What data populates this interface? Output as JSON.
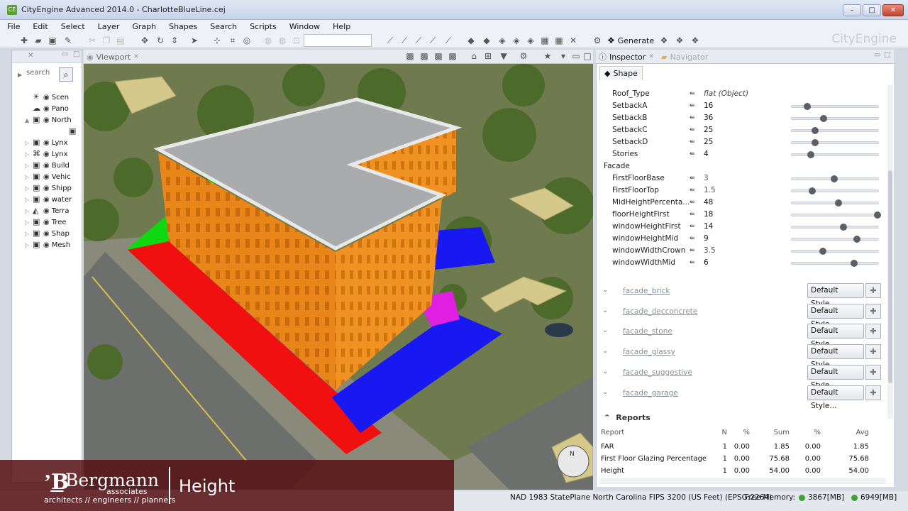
{
  "window": {
    "title": "CityEngine Advanced 2014.0 - CharlotteBlueLine.cej",
    "brand": "CityEngine"
  },
  "menu": [
    "File",
    "Edit",
    "Select",
    "Layer",
    "Graph",
    "Shapes",
    "Search",
    "Scripts",
    "Window",
    "Help"
  ],
  "toolbar": {
    "generate_label": "Generate"
  },
  "scene": {
    "search_placeholder": "search",
    "layers": [
      {
        "label": "Scen",
        "icon": "sun-icon"
      },
      {
        "label": "Pano",
        "icon": "cloud-icon"
      },
      {
        "label": "North",
        "icon": "cube-icon"
      },
      {
        "label": "",
        "icon": "cube-icon"
      },
      {
        "label": "Lynx",
        "icon": "cube-icon"
      },
      {
        "label": "Lynx",
        "icon": "network-icon"
      },
      {
        "label": "Build",
        "icon": "cube-icon"
      },
      {
        "label": "Vehic",
        "icon": "cube-icon"
      },
      {
        "label": "Shipp",
        "icon": "cube-icon"
      },
      {
        "label": "water",
        "icon": "cube-icon"
      },
      {
        "label": "Terra",
        "icon": "terrain-icon"
      },
      {
        "label": "Tree",
        "icon": "cube-icon"
      },
      {
        "label": "Shap",
        "icon": "cube-icon"
      },
      {
        "label": "Mesh",
        "icon": "cube-icon"
      }
    ]
  },
  "viewport": {
    "tab_label": "Viewport"
  },
  "inspector": {
    "tab_label": "Inspector",
    "navigator_label": "Navigator",
    "shape_tab": "Shape",
    "attributes": [
      {
        "name": "Roof_Type",
        "value": "flat (Object)",
        "slider": null
      },
      {
        "name": "SetbackA",
        "value": "16",
        "slider": 0.18
      },
      {
        "name": "SetbackB",
        "value": "36",
        "slider": 0.37
      },
      {
        "name": "SetbackC",
        "value": "25",
        "slider": 0.27
      },
      {
        "name": "SetbackD",
        "value": "25",
        "slider": 0.27
      },
      {
        "name": "Stories",
        "value": "4",
        "slider": 0.22
      }
    ],
    "facade_group": "Facade",
    "facade_attributes": [
      {
        "name": "FirstFloorBase",
        "value": "3",
        "slider": 0.49,
        "default": true
      },
      {
        "name": "FirstFloorTop",
        "value": "1.5",
        "slider": 0.24,
        "default": true
      },
      {
        "name": "MidHeightPercenta...",
        "value": "48",
        "slider": 0.54
      },
      {
        "name": "floorHeightFirst",
        "value": "18",
        "slider": 0.99
      },
      {
        "name": "windowHeightFirst",
        "value": "14",
        "slider": 0.6
      },
      {
        "name": "windowHeightMid",
        "value": "9",
        "slider": 0.75
      },
      {
        "name": "windowWidthCrown",
        "value": "3.5",
        "slider": 0.36,
        "default": true
      },
      {
        "name": "windowWidthMid",
        "value": "6",
        "slider": 0.72
      }
    ],
    "styles": [
      {
        "name": "facade_brick",
        "button": "Default Style..."
      },
      {
        "name": "facade_decconcrete",
        "button": "Default Style..."
      },
      {
        "name": "facade_stone",
        "button": "Default Style..."
      },
      {
        "name": "facade_glassy",
        "button": "Default Style..."
      },
      {
        "name": "facade_suggestive",
        "button": "Default Style..."
      },
      {
        "name": "facade_garage",
        "button": "Default Style..."
      }
    ],
    "reports": {
      "title": "Reports",
      "headers": [
        "Report",
        "N",
        "%",
        "Sum",
        "%",
        "Avg"
      ],
      "rows": [
        [
          "FAR",
          "1",
          "0.00",
          "1.85",
          "0.00",
          "1.85"
        ],
        [
          "First Floor Glazing Percentage",
          "1",
          "0.00",
          "75.68",
          "0.00",
          "75.68"
        ],
        [
          "Height",
          "1",
          "0.00",
          "54.00",
          "0.00",
          "54.00"
        ]
      ]
    }
  },
  "status": {
    "crs": "NAD 1983 StatePlane North Carolina FIPS 3200 (US Feet) (EPSG:2264)",
    "free_memory_label": "Free Memory:",
    "memory1": "3867[MB]",
    "memory2": "6949[MB]"
  },
  "overlay": {
    "brand": "Bergmann",
    "brand_sub": "associates",
    "tagline": "architects // engineers // planners",
    "topic": "Height"
  },
  "colors": {
    "building_facade": "#e8861a",
    "roof": "#a9abad",
    "lot_red": "#f01010",
    "lot_blue": "#1818f0",
    "lot_green": "#10d810",
    "lot_magenta": "#e020e0",
    "overlay": "#5a1015",
    "accent": "#5aa12e"
  }
}
